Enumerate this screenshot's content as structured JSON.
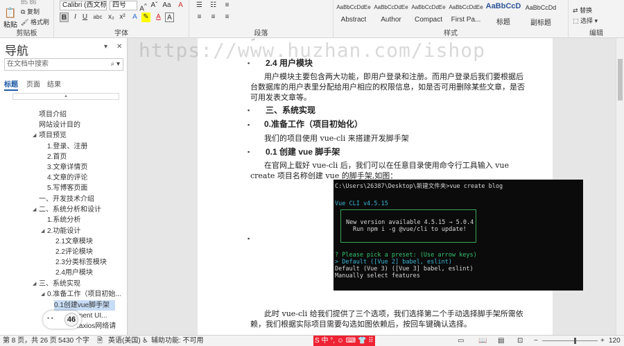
{
  "ribbon": {
    "clipboard": {
      "paste": "粘贴",
      "copy": "复制",
      "format_painter": "格式刷",
      "label": "剪贴板",
      "cut": "85 86"
    },
    "font": {
      "name": "Calibri (西文标",
      "size": "四号",
      "label": "字体"
    },
    "paragraph": {
      "label": "段落"
    },
    "styles": {
      "label": "样式",
      "tiles": [
        {
          "sample": "AaBbCcDdEe",
          "name": "Abstract"
        },
        {
          "sample": "AaBbCcDdEe",
          "name": "Author"
        },
        {
          "sample": "AaBbCcDdEe",
          "name": "Compact"
        },
        {
          "sample": "AaBbCcDdEe",
          "name": "First Pa..."
        },
        {
          "sample": "AaBbCcD",
          "name": "标题"
        },
        {
          "sample": "AaBbCcDd",
          "name": "副标题"
        }
      ]
    },
    "editing": {
      "replace": "替换",
      "select": "选择",
      "label": "编辑"
    }
  },
  "nav": {
    "title": "导航",
    "search_placeholder": "在文档中搜索",
    "tabs": [
      "标题",
      "页面",
      "结果"
    ],
    "anchor": "▴",
    "items": [
      {
        "label": "项目介绍",
        "level": 1,
        "arrow": ""
      },
      {
        "label": "网站设计目的",
        "level": 1,
        "arrow": ""
      },
      {
        "label": "项目预览",
        "level": 1,
        "arrow": "◢"
      },
      {
        "label": "1.登录、注册",
        "level": 2,
        "arrow": ""
      },
      {
        "label": "2.首页",
        "level": 2,
        "arrow": ""
      },
      {
        "label": "3.文章详情页",
        "level": 2,
        "arrow": ""
      },
      {
        "label": "4.文章的评论",
        "level": 2,
        "arrow": ""
      },
      {
        "label": "5.写博客页面",
        "level": 2,
        "arrow": ""
      },
      {
        "label": "一、开发技术介绍",
        "level": 1,
        "arrow": ""
      },
      {
        "label": "二、系统分析和设计",
        "level": 1,
        "arrow": "◢"
      },
      {
        "label": "1.系统分析",
        "level": 2,
        "arrow": ""
      },
      {
        "label": "2.功能设计",
        "level": 2,
        "arrow": "◢"
      },
      {
        "label": "2.1文章模块",
        "level": 3,
        "arrow": ""
      },
      {
        "label": "2.2评论模块",
        "level": 3,
        "arrow": ""
      },
      {
        "label": "2.3分类标签模块",
        "level": 3,
        "arrow": ""
      },
      {
        "label": "2.4用户模块",
        "level": 3,
        "arrow": ""
      },
      {
        "label": "三、系统实现",
        "level": 1,
        "arrow": "◢"
      },
      {
        "label": "0.准备工作（项目初始...",
        "level": 2,
        "arrow": "◢"
      },
      {
        "label": "0.1创建vue脚手架",
        "level": 3,
        "arrow": "",
        "selected": true
      },
      {
        "label": "0.2 Element UI...",
        "level": 3,
        "arrow": ""
      },
      {
        "label": "0.3引入axios网络请",
        "level": 3,
        "arrow": ""
      }
    ],
    "badge": "46",
    "badge_dots": "• •"
  },
  "watermark": "https://www.huzhan.com/ishop",
  "document": {
    "lines": [
      {
        "text": "↵",
        "kind": "mark",
        "bullet": false
      },
      {
        "text": "2.4 用户模块",
        "kind": "h",
        "bullet": true
      },
      {
        "text": "用户模块主要包含两大功能，即用户登录和注册。而用户登录后我们要根据后",
        "kind": "p",
        "bullet": false
      },
      {
        "text": "台数据库的用户表里分配给用户相应的权限信息，如是否可用删除某些文章，是否",
        "kind": "p",
        "bullet": false
      },
      {
        "text": "可用发表文章等。",
        "kind": "p",
        "bullet": false
      },
      {
        "text": "三、系统实现",
        "kind": "h",
        "bullet": true
      },
      {
        "text": "0.准备工作（项目初始化）",
        "kind": "h",
        "bullet": true
      },
      {
        "text": "我们的项目使用 vue-cli 来搭建开发脚手架",
        "kind": "p",
        "bullet": false
      },
      {
        "text": "0.1 创建 vue 脚手架",
        "kind": "h",
        "bullet": true
      },
      {
        "text": "在官网上载好 vue-cli 后，我们可以在任意目录使用命令行工具输入 vue",
        "kind": "p",
        "bullet": false
      },
      {
        "text": "create 项目名称创建 vue 的脚手架,如图：",
        "kind": "p",
        "bullet": false
      },
      {
        "text": "此时 vue-cli 给我们提供了三个选项，我们选择第二个手动选择脚手架所需依",
        "kind": "p",
        "bullet": false
      },
      {
        "text": "赖，我们根据实际项目需要勾选如图依赖后，按回车键确认选择。",
        "kind": "p",
        "bullet": false
      }
    ]
  },
  "terminal": {
    "lines": [
      "C:\\Users\\26387\\Desktop\\新建文件夹>vue create blog",
      "Vue CLI v4.5.15",
      "New version available 4.5.15 → 5.0.4",
      "Run npm i -g @vue/cli to update!",
      "? Please pick a preset: (Use arrow keys)",
      "> Default ([Vue 2] babel, eslint)",
      "  Default (Vue 3) ([Vue 3] babel, eslint)",
      "  Manually select features"
    ]
  },
  "status": {
    "page": "第 8 页，共 26 页",
    "words": "5430 个字",
    "lang": "英语(美国)",
    "access": "辅助功能: 不可用",
    "zoom": "120",
    "ime": "S 中 °, ☺ ⌨ 👕 ⠿",
    "colors": {
      "accent": "#1f5aa6",
      "selected": "#c7dcf5"
    }
  }
}
